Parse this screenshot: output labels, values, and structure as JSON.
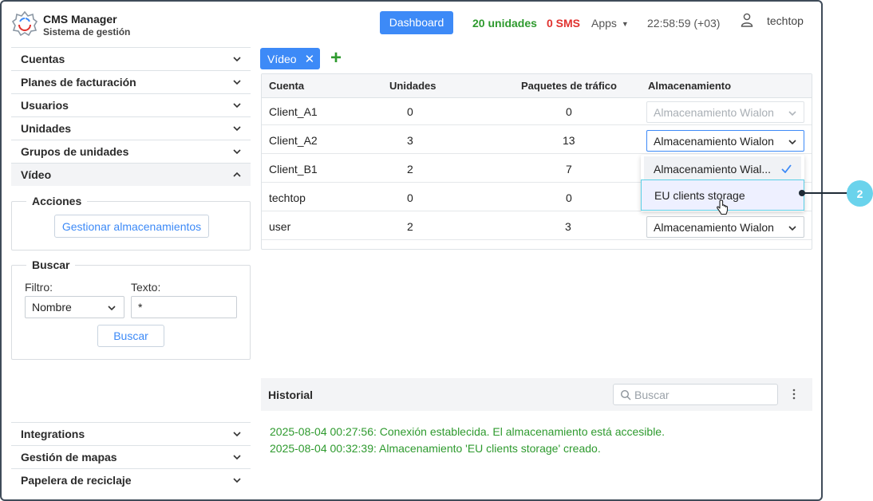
{
  "header": {
    "brand_title": "CMS Manager",
    "brand_subtitle": "Sistema de gestión",
    "dashboard_label": "Dashboard",
    "units": "20 unidades",
    "sms": "0 SMS",
    "apps": "Apps",
    "time": "22:58:59 (+03)",
    "user": "techtop"
  },
  "sidebar": {
    "items": [
      {
        "label": "Cuentas"
      },
      {
        "label": "Planes de facturación"
      },
      {
        "label": "Usuarios"
      },
      {
        "label": "Unidades"
      },
      {
        "label": "Grupos de unidades"
      },
      {
        "label": "Vídeo"
      }
    ],
    "bottom_items": [
      {
        "label": "Integrations"
      },
      {
        "label": "Gestión de mapas"
      },
      {
        "label": "Papelera de reciclaje"
      }
    ],
    "actions": {
      "legend": "Acciones",
      "manage_button": "Gestionar almacenamientos"
    },
    "search": {
      "legend": "Buscar",
      "filter_label": "Filtro:",
      "text_label": "Texto:",
      "filter_value": "Nombre",
      "text_value": "*",
      "search_button": "Buscar"
    }
  },
  "tabs": {
    "video_label": "Vídeo",
    "add_label": "+"
  },
  "table": {
    "columns": [
      "Cuenta",
      "Unidades",
      "Paquetes de tráfico",
      "Almacenamiento"
    ],
    "rows": [
      {
        "cuenta": "Client_A1",
        "unidades": "0",
        "paquetes": "0",
        "almacenamiento": "Almacenamiento Wialon"
      },
      {
        "cuenta": "Client_A2",
        "unidades": "3",
        "paquetes": "13",
        "almacenamiento": "Almacenamiento Wialon"
      },
      {
        "cuenta": "Client_B1",
        "unidades": "2",
        "paquetes": "7",
        "almacenamiento": ""
      },
      {
        "cuenta": "techtop",
        "unidades": "0",
        "paquetes": "0",
        "almacenamiento": ""
      },
      {
        "cuenta": "user",
        "unidades": "2",
        "paquetes": "3",
        "almacenamiento": "Almacenamiento Wialon"
      }
    ]
  },
  "dropdown": {
    "options": [
      "Almacenamiento Wial...",
      "EU clients storage"
    ]
  },
  "callout": {
    "number": "2"
  },
  "history": {
    "title": "Historial",
    "search_placeholder": "Buscar",
    "logs": [
      "2025-08-04 00:27:56: Conexión establecida. El almacenamiento está accesible.",
      "2025-08-04 00:32:39: Almacenamiento 'EU clients storage' creado."
    ]
  },
  "colors": {
    "accent": "#3d8af7",
    "success": "#2e9a2e",
    "danger": "#e0322f",
    "callout": "#6ad3ec"
  }
}
